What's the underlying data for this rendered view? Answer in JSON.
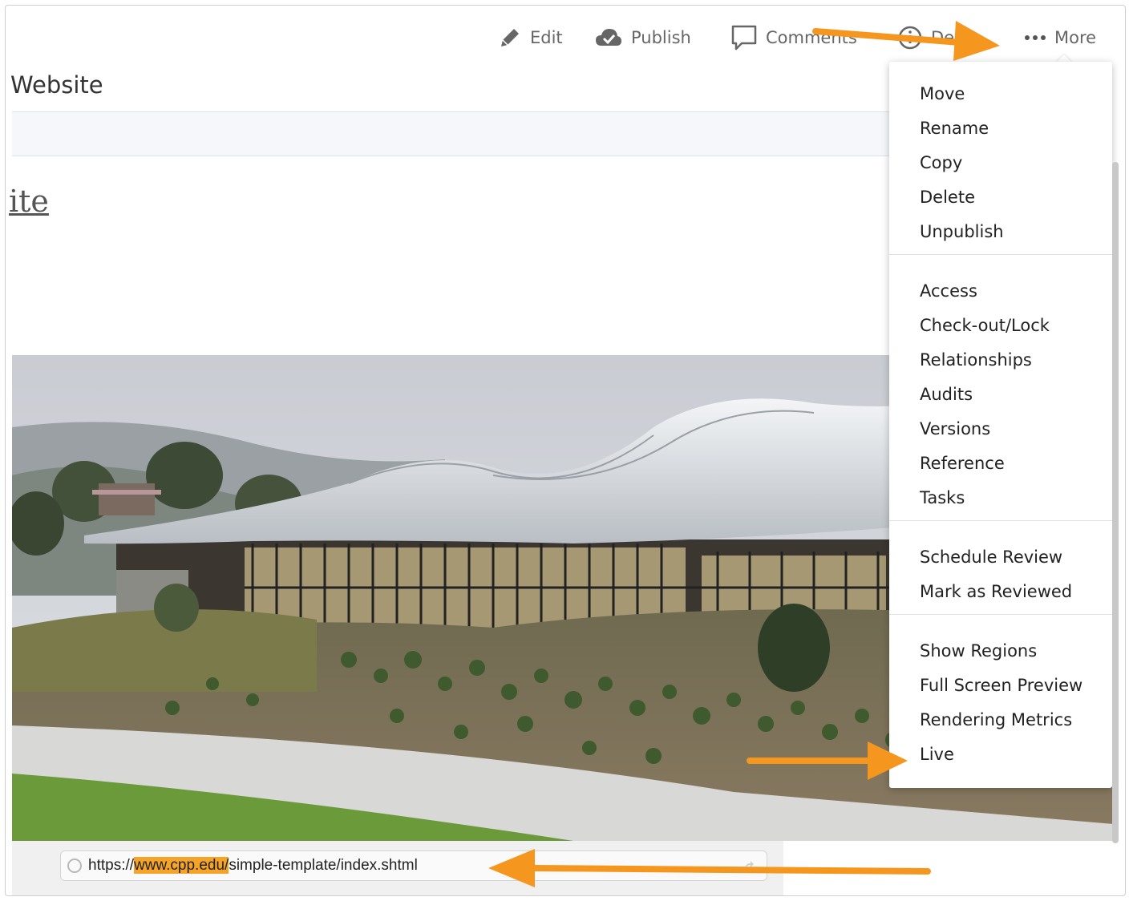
{
  "toolbar": {
    "edit_label": "Edit",
    "publish_label": "Publish",
    "comments_label": "Comments",
    "details_label": "De",
    "more_label": "More"
  },
  "page": {
    "title": "Website",
    "site_heading": "ite"
  },
  "menu": {
    "groups": [
      [
        "Move",
        "Rename",
        "Copy",
        "Delete",
        "Unpublish"
      ],
      [
        "Access",
        "Check-out/Lock",
        "Relationships",
        "Audits",
        "Versions",
        "Reference",
        "Tasks"
      ],
      [
        "Schedule Review",
        "Mark as Reviewed"
      ],
      [
        "Show Regions",
        "Full Screen Preview",
        "Rendering Metrics",
        "Live"
      ]
    ]
  },
  "url": {
    "prefix": "https://",
    "highlight": "www.cpp.edu/",
    "rest": "simple-template/index.shtml"
  },
  "colors": {
    "arrow": "#f5961e",
    "highlight": "#f5a428"
  }
}
